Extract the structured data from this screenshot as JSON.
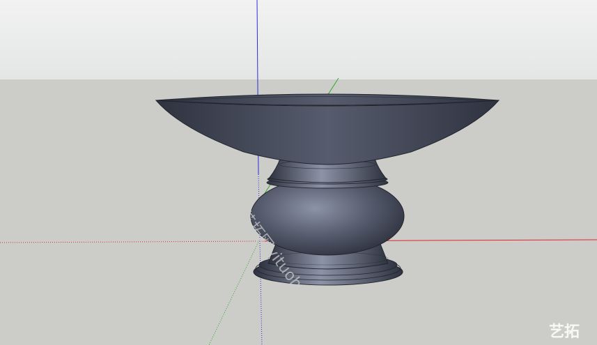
{
  "viewport": {
    "sky_color": "#f1f2f1",
    "sky_gradient_bottom": "#e4e6e5",
    "ground_color": "#cccdc8",
    "model_color": "#565c6d",
    "model_highlight_color": "#8c93a6",
    "model_shadow_color": "#2f3340",
    "edge_color": "#22252e"
  },
  "axes": {
    "red_axis_color": "#e0262a",
    "green_axis_color": "#2ea82e",
    "blue_axis_color": "#2a2ad8"
  },
  "model": {
    "object_name": "vase",
    "parts": [
      "bowl",
      "neck",
      "body",
      "foot"
    ]
  },
  "watermark": {
    "text": "艺拓网yituohub.com",
    "corner_logo": "艺拓"
  }
}
